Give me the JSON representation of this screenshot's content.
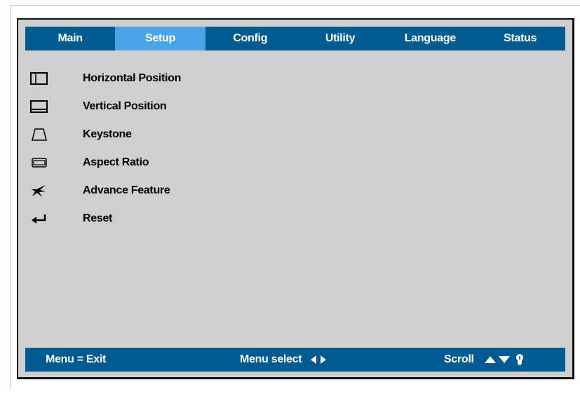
{
  "tabs": [
    {
      "label": "Main",
      "active": false
    },
    {
      "label": "Setup",
      "active": true
    },
    {
      "label": "Config",
      "active": false
    },
    {
      "label": "Utility",
      "active": false
    },
    {
      "label": "Language",
      "active": false
    },
    {
      "label": "Status",
      "active": false
    }
  ],
  "menu_items": [
    {
      "label": "Horizontal Position",
      "icon": "horizontal-position-icon"
    },
    {
      "label": "Vertical Position",
      "icon": "vertical-position-icon"
    },
    {
      "label": "Keystone",
      "icon": "keystone-icon"
    },
    {
      "label": "Aspect Ratio",
      "icon": "aspect-ratio-icon"
    },
    {
      "label": "Advance Feature",
      "icon": "advance-feature-icon"
    },
    {
      "label": "Reset",
      "icon": "reset-icon"
    }
  ],
  "footer": {
    "exit_hint": "Menu = Exit",
    "select_hint": "Menu select",
    "scroll_hint": "Scroll"
  },
  "colors": {
    "bar": "#005b91",
    "active_tab": "#4aa3e4",
    "panel": "#cfcfcf"
  }
}
